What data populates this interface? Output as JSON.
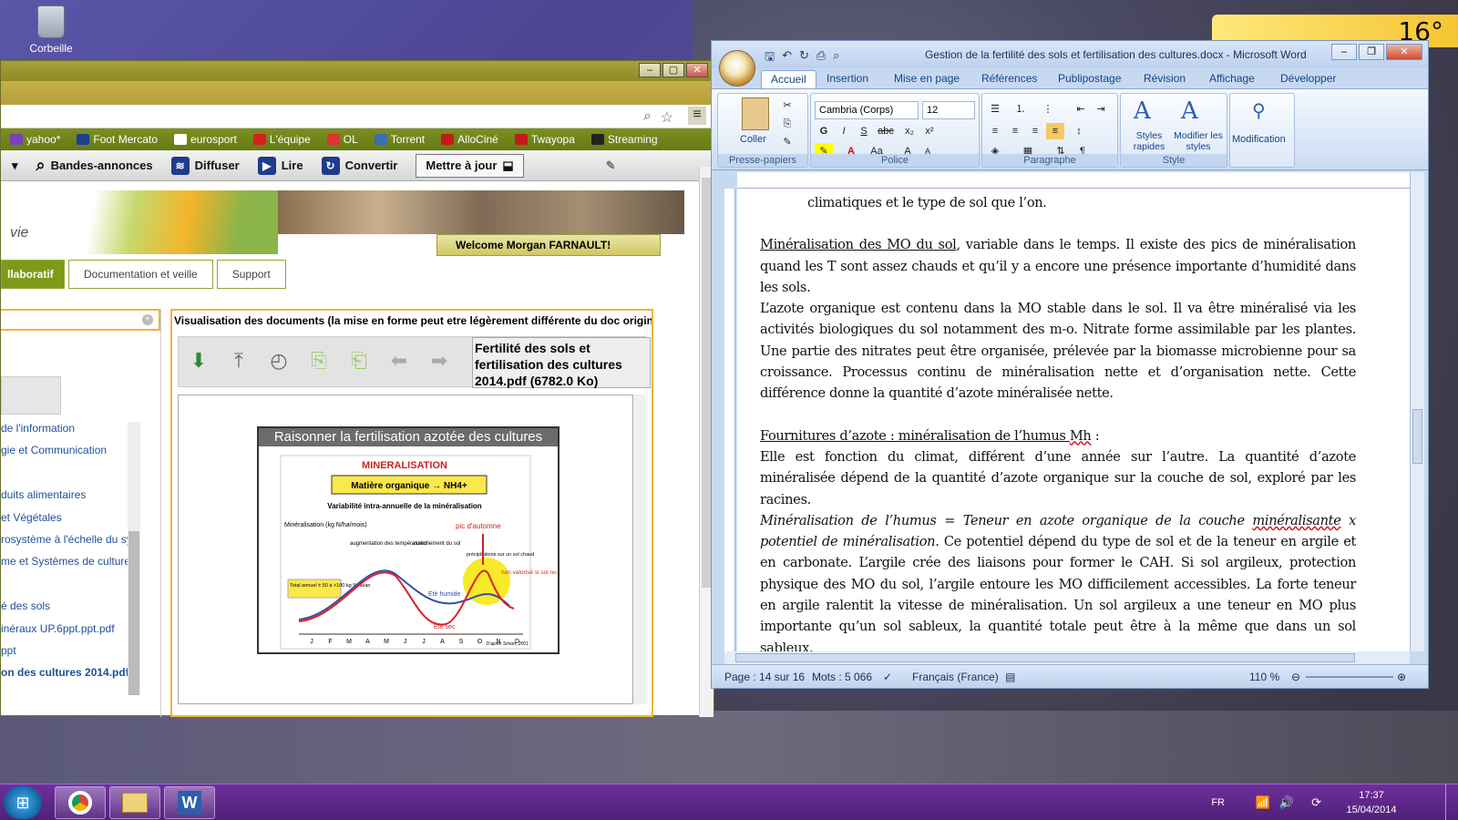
{
  "desktop": {
    "recycle_label": "Corbeille",
    "weather_temp": "16°"
  },
  "browser": {
    "bookmarks": [
      "yahoo*",
      "Foot Mercato",
      "eurosport",
      "L'équipe",
      "OL",
      "Torrent",
      "AlloCiné",
      "Twayopa",
      "Streaming"
    ],
    "toolbar": {
      "trailers": "Bandes-annonces",
      "broadcast": "Diffuser",
      "read": "Lire",
      "convert": "Convertir",
      "update": "Mettre à jour"
    },
    "banner": {
      "vie": "vie",
      "welcome": "Welcome Morgan FARNAULT!"
    },
    "nav_tabs": [
      "llaboratif",
      "Documentation et veille",
      "Support"
    ],
    "left_list": [
      "de l'information",
      "gie et Communication",
      "",
      "duits alimentaires",
      "et Végétales",
      "rosystème à l'échelle du sy",
      "me et Systèmes de culture",
      "",
      "é des sols",
      "inéraux UP.6ppt.ppt.pdf",
      "ppt",
      "on des cultures 2014.pdf"
    ],
    "viewer": {
      "header": "Visualisation des documents (la mise en forme peut etre légèrement différente du doc origin",
      "file_name": "Fertilité des sols et fertilisation des cultures 2014.pdf (6782.0 Ko)",
      "slide": {
        "title": "Raisonner la fertilisation azotée des cultures",
        "heading": "MINERALISATION",
        "box": "Matière organique → NH4+",
        "subtitle": "Variabilité intra-annuelle de la minéralisation",
        "ylabel": "Minéralisation (kg N/ha/mois)",
        "label_aug": "augmentation des températures",
        "label_ass": "assèchement du sol",
        "label_precip": "précipitations sur un sol chaud",
        "label_pic": "pic d'automne",
        "label_total": "Total annuel ± 50 à >100 kg N/ha/an",
        "label_humide": "Eté humide",
        "label_sec": "Eté sec",
        "label_non": "non valorisé si sol nu",
        "months": [
          "J",
          "F",
          "M",
          "A",
          "M",
          "J",
          "J",
          "A",
          "S",
          "O",
          "N",
          "D"
        ],
        "credit": "D'après Simon, 2001"
      }
    }
  },
  "word": {
    "title": "Gestion de la fertilité des sols et fertilisation des cultures.docx - Microsoft Word",
    "tabs": [
      "Accueil",
      "Insertion",
      "Mise en page",
      "Références",
      "Publipostage",
      "Révision",
      "Affichage",
      "Développer"
    ],
    "ribbon": {
      "paste": "Coller",
      "clipboard": "Presse-papiers",
      "font_name": "Cambria (Corps)",
      "font_size": "12",
      "font_group": "Police",
      "paragraph_group": "Paragraphe",
      "styles_quick": "Styles rapides",
      "styles_modify": "Modifier les styles",
      "style_group": "Style",
      "editing": "Modification"
    },
    "doc": {
      "p0": "climatiques et le type de sol que l’on.",
      "p1_title": "Minéralisation des MO du sol",
      "p1_rest": ", variable dans le temps. Il existe des pics de minéralisation quand les T sont assez chauds et qu’il y a encore une présence importante d’humidité dans les sols.",
      "p2": "L’azote organique est contenu dans la MO stable dans le sol. Il va être minéralisé via les activités biologiques du sol notamment des m-o. Nitrate forme assimilable par les plantes. Une partie des nitrates peut être organisée, prélevée par la biomasse microbienne pour sa croissance. Processus continu de minéralisation nette et d’organisation nette. Cette différence donne la quantité d’azote minéralisée nette.",
      "p3_title_a": "Fournitures d’azote : minéralisation de l’humus ",
      "p3_title_b": "Mh",
      "p3_colon": " :",
      "p4": "Elle est fonction du climat, différent d’une année sur l’autre. La quantité d’azote minéralisée dépend de la quantité d’azote organique sur la couche de sol, exploré par les racines.",
      "p5_italic_a": "Minéralisation de l’humus = Teneur en azote organique de la couche ",
      "p5_italic_b": "minéralisante",
      "p5_italic_c": " x potentiel de minéralisation.",
      "p5_rest": " Ce potentiel dépend du type de sol et de la teneur en argile et en carbonate. L’argile crée des liaisons pour former le CAH. Si sol argileux, protection physique des MO du sol, l’argile entoure les MO difficilement accessibles. La forte teneur en argile ralentit la vitesse de minéralisation. Un sol argileux a une teneur en MO plus importante qu’un sol sableux, la quantité totale peut être à la même que dans un sol sableux."
    },
    "status": {
      "page": "Page : 14 sur 16",
      "words": "Mots : 5 066",
      "lang": "Français (France)",
      "zoom": "110 %"
    }
  },
  "taskbar": {
    "lang": "FR",
    "time": "17:37",
    "date": "15/04/2014"
  }
}
